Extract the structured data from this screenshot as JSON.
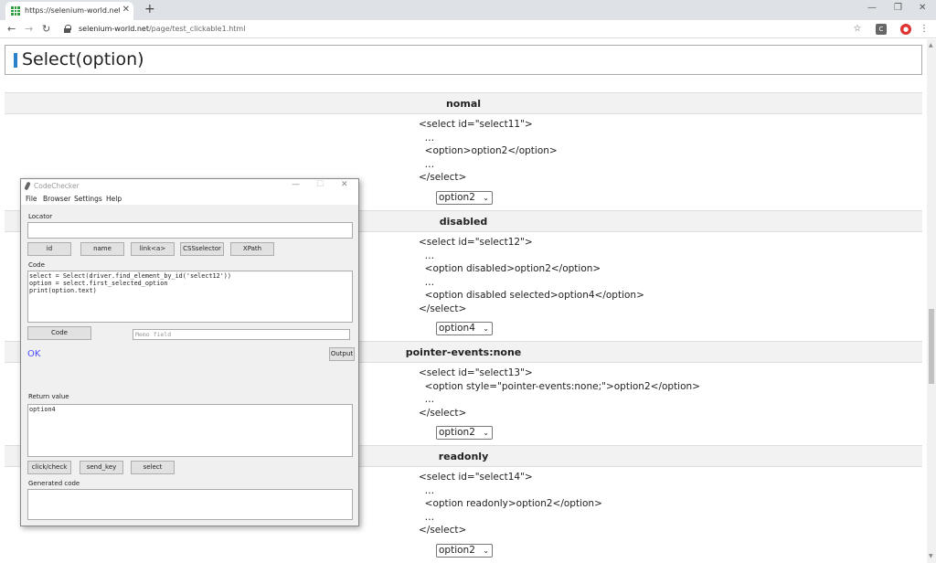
{
  "browser": {
    "tab_title": "https://selenium-world.net/page/",
    "tab_close": "✕",
    "new_tab": "+",
    "url_host": "selenium-world.net",
    "url_path": "/page/test_clickable1.html",
    "ext_label": "C"
  },
  "page": {
    "heading": "Select(option)",
    "sections": [
      {
        "header": "nomal",
        "code_lines": [
          "<select id=\"select11\">",
          "  …",
          "  <option>option2</option>",
          "  …",
          "</select>"
        ],
        "select_value": "option2"
      },
      {
        "header": "disabled",
        "code_lines": [
          "<select id=\"select12\">",
          "  …",
          "  <option disabled>option2</option>",
          "  …",
          "  <option disabled selected>option4</option>",
          "</select>"
        ],
        "select_value": "option4"
      },
      {
        "header": "pointer-events:none",
        "code_lines": [
          "<select id=\"select13\">",
          "  <option style=\"pointer-events:none;\">option2</option>",
          "  …",
          "</select>"
        ],
        "select_value": "option2"
      },
      {
        "header": "readonly",
        "code_lines": [
          "<select id=\"select14\">",
          "  …",
          "  <option readonly>option2</option>",
          "  …",
          "</select>"
        ],
        "select_value": "option2"
      }
    ]
  },
  "codechecker": {
    "title": "CodeChecker",
    "menu": [
      "File",
      "Browser",
      "Settings",
      "Help"
    ],
    "locator_label": "Locator",
    "locator_value": "",
    "locator_buttons": [
      "id",
      "name",
      "link<a>",
      "CSSselector",
      "XPath"
    ],
    "code_label": "Code",
    "code_text": "select = Select(driver.find_element_by_id('select12'))\noption = select.first_selected_option\nprint(option.text)",
    "code_button": "Code",
    "memo_placeholder": "Memo field",
    "status": "OK",
    "output_button": "Output",
    "return_label": "Return value",
    "return_value": "option4",
    "action_buttons": [
      "click/check",
      "send_key",
      "select"
    ],
    "generated_label": "Generated code",
    "generated_value": ""
  }
}
